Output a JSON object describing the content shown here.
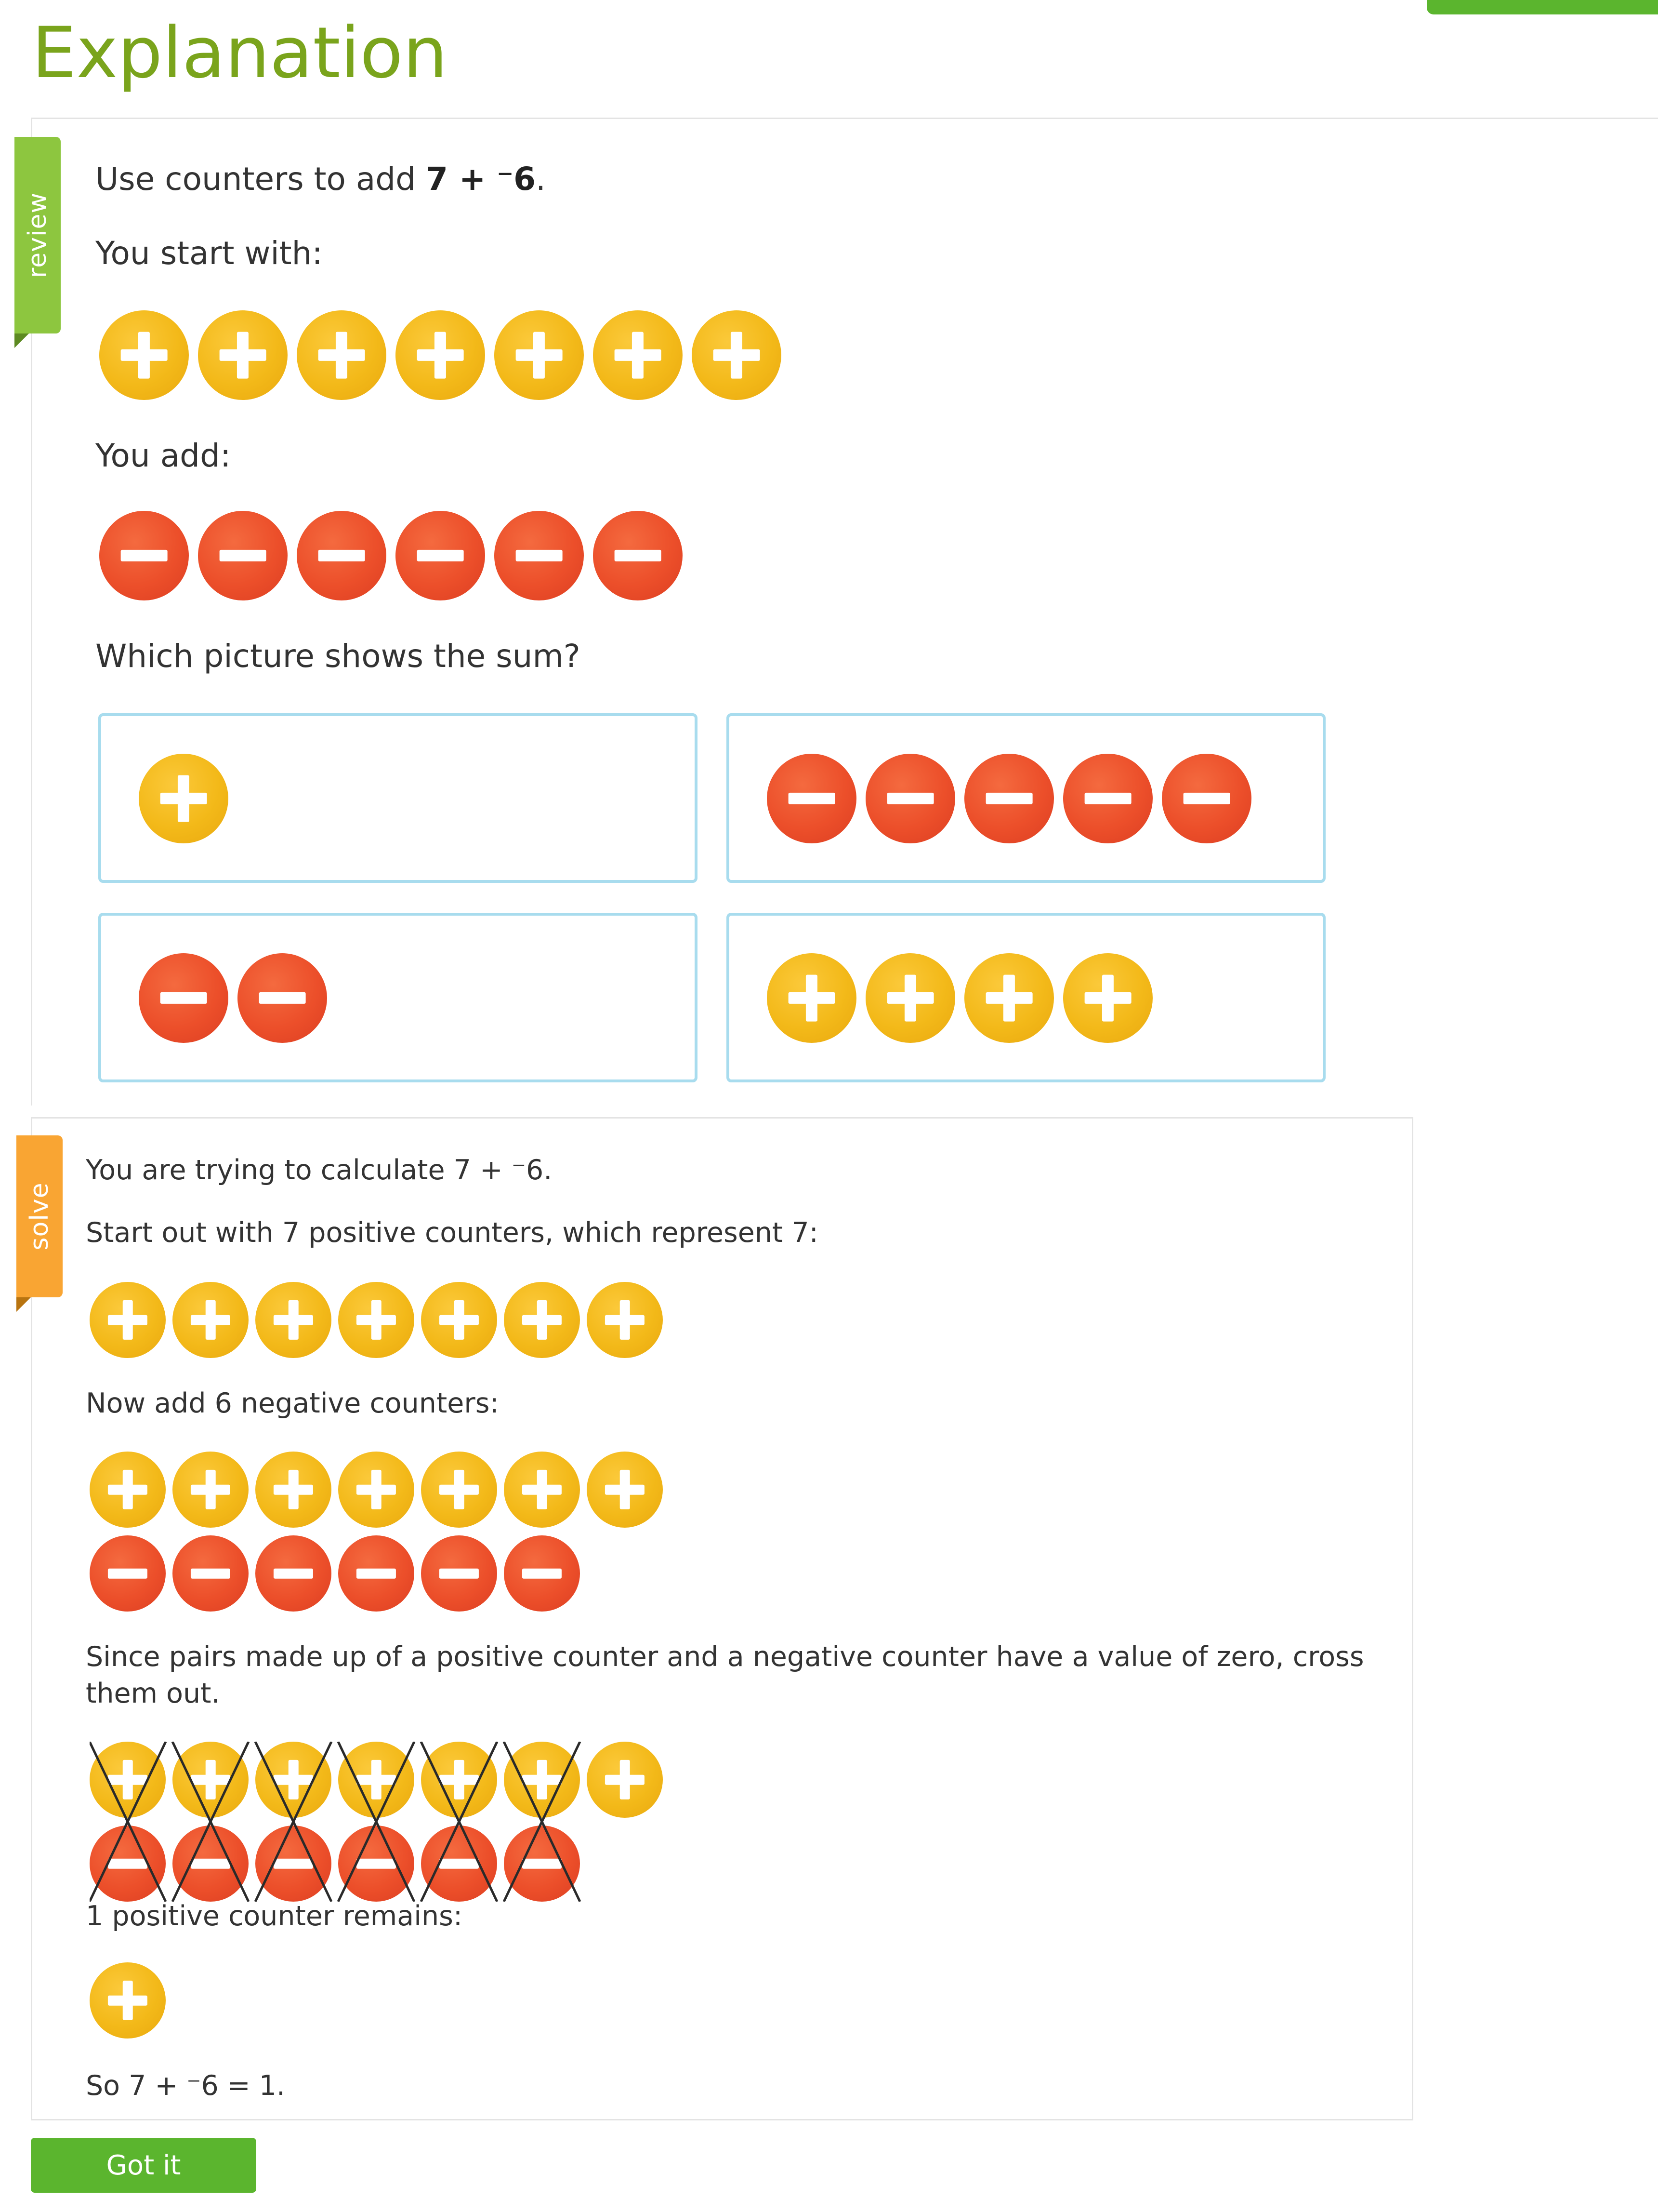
{
  "page": {
    "title": "Explanation",
    "button_label": "Got it",
    "accent_color": "#5bb52e"
  },
  "review": {
    "tab_label": "review",
    "tab_color": "#8dc63f",
    "question_prefix": "Use counters to add ",
    "question_expr": "7 + ⁻6",
    "question_suffix": ".",
    "start_label": "You start with:",
    "start_counters": {
      "sign": "positive",
      "count": 7
    },
    "add_label": "You add:",
    "add_counters": {
      "sign": "negative",
      "count": 6
    },
    "prompt": "Which picture shows the sum?",
    "choices": [
      {
        "sign": "positive",
        "count": 1
      },
      {
        "sign": "negative",
        "count": 5
      },
      {
        "sign": "negative",
        "count": 2
      },
      {
        "sign": "positive",
        "count": 4
      }
    ]
  },
  "solve": {
    "tab_label": "solve",
    "tab_color": "#f9a533",
    "line1": "You are trying to calculate 7 + ⁻6.",
    "line2": "Start out with 7 positive counters, which represent 7:",
    "step1_counters": {
      "positive": 7
    },
    "line3": "Now add 6 negative counters:",
    "step2_counters": {
      "positive": 7,
      "negative": 6
    },
    "line4a": "Since pairs made up of a positive counter and a negative counter have a value of zero, cross",
    "line4b": "them out.",
    "step3_counters": {
      "positive": 7,
      "negative": 6,
      "crossed_pairs": 6
    },
    "line5": "1 positive counter remains:",
    "step4_counters": {
      "positive": 1
    },
    "line6": "So 7 + ⁻6 = 1."
  },
  "icons": {
    "positive_counter": "plus-counter-icon",
    "negative_counter": "minus-counter-icon",
    "positive_color": "#f3b919",
    "negative_color": "#ec4f2a"
  }
}
